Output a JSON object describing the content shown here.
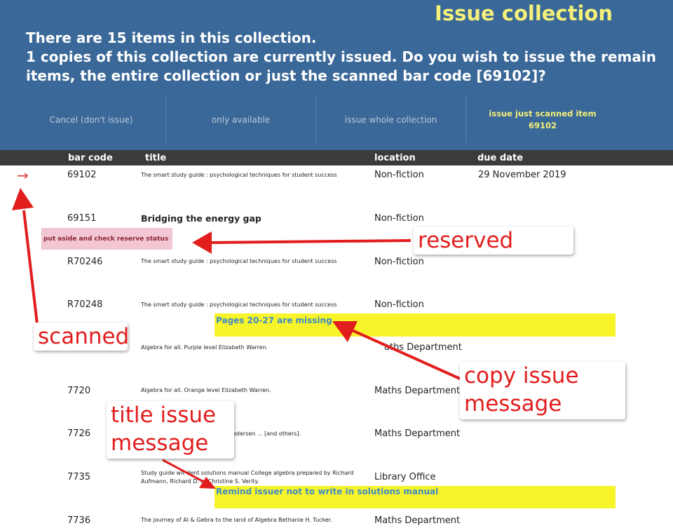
{
  "header": {
    "title": "Issue collection",
    "line1": "There are 15 items in this collection.",
    "line2": "1 copies of this collection are currently issued. Do you wish to issue the remain",
    "line3": "items, the entire collection or just the scanned bar code [69102]?"
  },
  "actions": {
    "cancel": "Cancel (don't issue)",
    "only_available": "only available",
    "whole": "issue whole collection",
    "scanned_line1": "issue just scanned item",
    "scanned_line2": "69102"
  },
  "columns": {
    "barcode": "bar code",
    "title": "title",
    "location": "location",
    "due": "due date"
  },
  "rows": [
    {
      "barcode": "69102",
      "title": "The smart study guide : psychological techniques for student success",
      "location": "Non-fiction",
      "due": "29 November 2019"
    },
    {
      "barcode": "69151",
      "title": "Bridging the energy gap",
      "location": "Non-fiction",
      "due": ""
    },
    {
      "barcode": "R70246",
      "title": "The smart study guide : psychological techniques for student success",
      "location": "Non-fiction",
      "due": ""
    },
    {
      "barcode": "R70248",
      "title": "The smart study guide : psychological techniques for student success",
      "location": "Non-fiction",
      "due": ""
    },
    {
      "barcode": "",
      "title": "Algebra for all. Purple level Elizabeth Warren.",
      "location": "aths Department",
      "due": ""
    },
    {
      "barcode": "7720",
      "title": "Algebra for all. Orange level Elizabeth Warren.",
      "location": "Maths Department",
      "due": ""
    },
    {
      "barcode": "7726",
      "title": "edersen ... [and others].",
      "location": "Maths Department",
      "due": ""
    },
    {
      "barcode": "7735",
      "title_line1": "Study guide wit         dent solutions manual College algebra prepared by Richard",
      "title_line2": "Aufmann, Richard D.          n, Christine S. Verity.",
      "location": "Library Office",
      "due": ""
    },
    {
      "barcode": "7736",
      "title": "The journey of Al & Gebra to the land of Algebra Bethanie H. Tucker.",
      "location": "Maths Department",
      "due": ""
    }
  ],
  "reserve_status": "put aside and check reserve status",
  "copy_issue_message": "Pages 20-27 are missing",
  "title_issue_message": "Remind issuer not to write in solutions manual",
  "scanned_marker_icon": "right-arrow-icon",
  "annotations": {
    "reserved": "reserved",
    "scanned": "scanned",
    "copy_issue_line1": "copy issue",
    "copy_issue_line2": "message",
    "title_issue_line1": "title issue",
    "title_issue_line2": "message"
  },
  "colors": {
    "header_bg": "#3a6898",
    "title_yellow": "#f4f07a",
    "message_yellow": "#f8f42a",
    "annotation_red": "#e21d1d"
  }
}
